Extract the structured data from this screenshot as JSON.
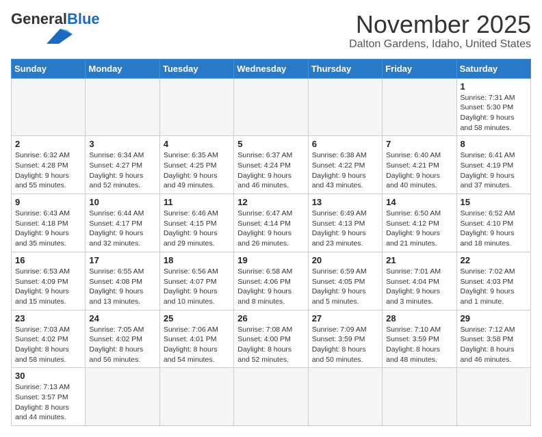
{
  "header": {
    "logo_text_general": "General",
    "logo_text_blue": "Blue",
    "month_year": "November 2025",
    "location": "Dalton Gardens, Idaho, United States"
  },
  "weekdays": [
    "Sunday",
    "Monday",
    "Tuesday",
    "Wednesday",
    "Thursday",
    "Friday",
    "Saturday"
  ],
  "weeks": [
    [
      {
        "day": "",
        "info": ""
      },
      {
        "day": "",
        "info": ""
      },
      {
        "day": "",
        "info": ""
      },
      {
        "day": "",
        "info": ""
      },
      {
        "day": "",
        "info": ""
      },
      {
        "day": "",
        "info": ""
      },
      {
        "day": "1",
        "info": "Sunrise: 7:31 AM\nSunset: 5:30 PM\nDaylight: 9 hours\nand 58 minutes."
      }
    ],
    [
      {
        "day": "2",
        "info": "Sunrise: 6:32 AM\nSunset: 4:28 PM\nDaylight: 9 hours\nand 55 minutes."
      },
      {
        "day": "3",
        "info": "Sunrise: 6:34 AM\nSunset: 4:27 PM\nDaylight: 9 hours\nand 52 minutes."
      },
      {
        "day": "4",
        "info": "Sunrise: 6:35 AM\nSunset: 4:25 PM\nDaylight: 9 hours\nand 49 minutes."
      },
      {
        "day": "5",
        "info": "Sunrise: 6:37 AM\nSunset: 4:24 PM\nDaylight: 9 hours\nand 46 minutes."
      },
      {
        "day": "6",
        "info": "Sunrise: 6:38 AM\nSunset: 4:22 PM\nDaylight: 9 hours\nand 43 minutes."
      },
      {
        "day": "7",
        "info": "Sunrise: 6:40 AM\nSunset: 4:21 PM\nDaylight: 9 hours\nand 40 minutes."
      },
      {
        "day": "8",
        "info": "Sunrise: 6:41 AM\nSunset: 4:19 PM\nDaylight: 9 hours\nand 37 minutes."
      }
    ],
    [
      {
        "day": "9",
        "info": "Sunrise: 6:43 AM\nSunset: 4:18 PM\nDaylight: 9 hours\nand 35 minutes."
      },
      {
        "day": "10",
        "info": "Sunrise: 6:44 AM\nSunset: 4:17 PM\nDaylight: 9 hours\nand 32 minutes."
      },
      {
        "day": "11",
        "info": "Sunrise: 6:46 AM\nSunset: 4:15 PM\nDaylight: 9 hours\nand 29 minutes."
      },
      {
        "day": "12",
        "info": "Sunrise: 6:47 AM\nSunset: 4:14 PM\nDaylight: 9 hours\nand 26 minutes."
      },
      {
        "day": "13",
        "info": "Sunrise: 6:49 AM\nSunset: 4:13 PM\nDaylight: 9 hours\nand 23 minutes."
      },
      {
        "day": "14",
        "info": "Sunrise: 6:50 AM\nSunset: 4:12 PM\nDaylight: 9 hours\nand 21 minutes."
      },
      {
        "day": "15",
        "info": "Sunrise: 6:52 AM\nSunset: 4:10 PM\nDaylight: 9 hours\nand 18 minutes."
      }
    ],
    [
      {
        "day": "16",
        "info": "Sunrise: 6:53 AM\nSunset: 4:09 PM\nDaylight: 9 hours\nand 15 minutes."
      },
      {
        "day": "17",
        "info": "Sunrise: 6:55 AM\nSunset: 4:08 PM\nDaylight: 9 hours\nand 13 minutes."
      },
      {
        "day": "18",
        "info": "Sunrise: 6:56 AM\nSunset: 4:07 PM\nDaylight: 9 hours\nand 10 minutes."
      },
      {
        "day": "19",
        "info": "Sunrise: 6:58 AM\nSunset: 4:06 PM\nDaylight: 9 hours\nand 8 minutes."
      },
      {
        "day": "20",
        "info": "Sunrise: 6:59 AM\nSunset: 4:05 PM\nDaylight: 9 hours\nand 5 minutes."
      },
      {
        "day": "21",
        "info": "Sunrise: 7:01 AM\nSunset: 4:04 PM\nDaylight: 9 hours\nand 3 minutes."
      },
      {
        "day": "22",
        "info": "Sunrise: 7:02 AM\nSunset: 4:03 PM\nDaylight: 9 hours\nand 1 minute."
      }
    ],
    [
      {
        "day": "23",
        "info": "Sunrise: 7:03 AM\nSunset: 4:02 PM\nDaylight: 8 hours\nand 58 minutes."
      },
      {
        "day": "24",
        "info": "Sunrise: 7:05 AM\nSunset: 4:02 PM\nDaylight: 8 hours\nand 56 minutes."
      },
      {
        "day": "25",
        "info": "Sunrise: 7:06 AM\nSunset: 4:01 PM\nDaylight: 8 hours\nand 54 minutes."
      },
      {
        "day": "26",
        "info": "Sunrise: 7:08 AM\nSunset: 4:00 PM\nDaylight: 8 hours\nand 52 minutes."
      },
      {
        "day": "27",
        "info": "Sunrise: 7:09 AM\nSunset: 3:59 PM\nDaylight: 8 hours\nand 50 minutes."
      },
      {
        "day": "28",
        "info": "Sunrise: 7:10 AM\nSunset: 3:59 PM\nDaylight: 8 hours\nand 48 minutes."
      },
      {
        "day": "29",
        "info": "Sunrise: 7:12 AM\nSunset: 3:58 PM\nDaylight: 8 hours\nand 46 minutes."
      }
    ],
    [
      {
        "day": "30",
        "info": "Sunrise: 7:13 AM\nSunset: 3:57 PM\nDaylight: 8 hours\nand 44 minutes."
      },
      {
        "day": "",
        "info": ""
      },
      {
        "day": "",
        "info": ""
      },
      {
        "day": "",
        "info": ""
      },
      {
        "day": "",
        "info": ""
      },
      {
        "day": "",
        "info": ""
      },
      {
        "day": "",
        "info": ""
      }
    ]
  ]
}
